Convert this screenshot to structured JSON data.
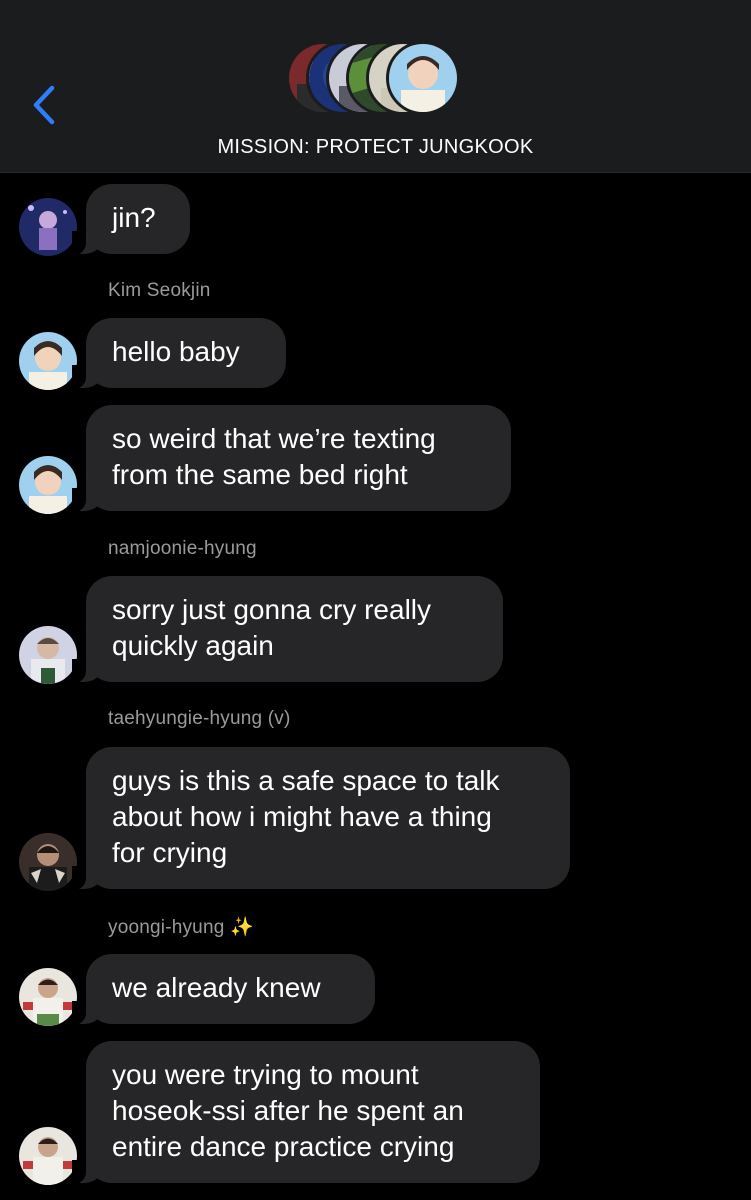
{
  "header": {
    "title": "MISSION: PROTECT JUNGKOOK",
    "back_icon": "chevron-left-icon",
    "accent_color": "#2f7dfa",
    "group_avatars": [
      "member-1",
      "member-2",
      "member-3",
      "member-4",
      "member-5",
      "member-6"
    ]
  },
  "messages": [
    {
      "sender": "",
      "text_lines": [
        "jin?"
      ],
      "avatar": "purple-stage-avatar"
    },
    {
      "sender": "Kim Seokjin",
      "text_lines": [
        "hello baby"
      ],
      "avatar": "jin-avatar"
    },
    {
      "sender": "",
      "text_lines": [
        "so weird that we’re texting",
        "from the same bed right"
      ],
      "avatar": "jin-avatar"
    },
    {
      "sender": "namjoonie-hyung",
      "text_lines": [
        "sorry just gonna cry really",
        "quickly again"
      ],
      "avatar": "namjoon-avatar"
    },
    {
      "sender": "taehyungie-hyung (v)",
      "text_lines": [
        "guys is this a safe space to talk",
        "about how i might have a thing",
        "for crying"
      ],
      "avatar": "taehyung-avatar"
    },
    {
      "sender": "yoongi-hyung ✨",
      "text_lines": [
        "we already knew"
      ],
      "avatar": "yoongi-avatar"
    },
    {
      "sender": "",
      "text_lines": [
        "you were trying to mount",
        "hoseok-ssi after he spent an",
        "entire dance practice crying"
      ],
      "avatar": "yoongi-avatar"
    }
  ]
}
